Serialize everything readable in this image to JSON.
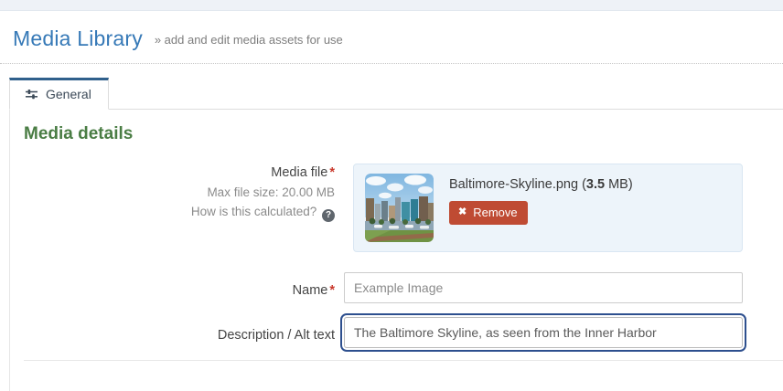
{
  "header": {
    "title": "Media Library",
    "subtitle": "» add and edit media assets for use"
  },
  "tabs": [
    {
      "label": "General",
      "icon": "sliders-icon",
      "active": true
    }
  ],
  "content": {
    "heading": "Media details"
  },
  "form": {
    "media_file": {
      "label": "Media file",
      "required": "*",
      "max_size_note": "Max file size: 20.00 MB",
      "help_text": "How is this calculated?",
      "help_icon": "?",
      "file": {
        "display_name": "Baltimore-Skyline.png",
        "size_open": " (",
        "size_value": "3.5",
        "size_close": " MB)",
        "thumbnail": "baltimore-skyline-photo",
        "remove_icon": "✖",
        "remove_label": "Remove"
      }
    },
    "name": {
      "label": "Name",
      "required": "*",
      "value": "Example Image"
    },
    "description": {
      "label": "Description / Alt text",
      "value": "The Baltimore Skyline, as seen from the Inner Harbor"
    }
  },
  "colors": {
    "title_blue": "#3679b7",
    "heading_green": "#4a7d44",
    "tab_top_border": "#30608c",
    "required_red": "#c9392c",
    "remove_button_bg": "#bf4b33",
    "preview_bg": "#edf4fa",
    "preview_border": "#d9e6f2",
    "focus_ring": "#2d4f8e",
    "topbar_bg": "#eef2f7"
  }
}
